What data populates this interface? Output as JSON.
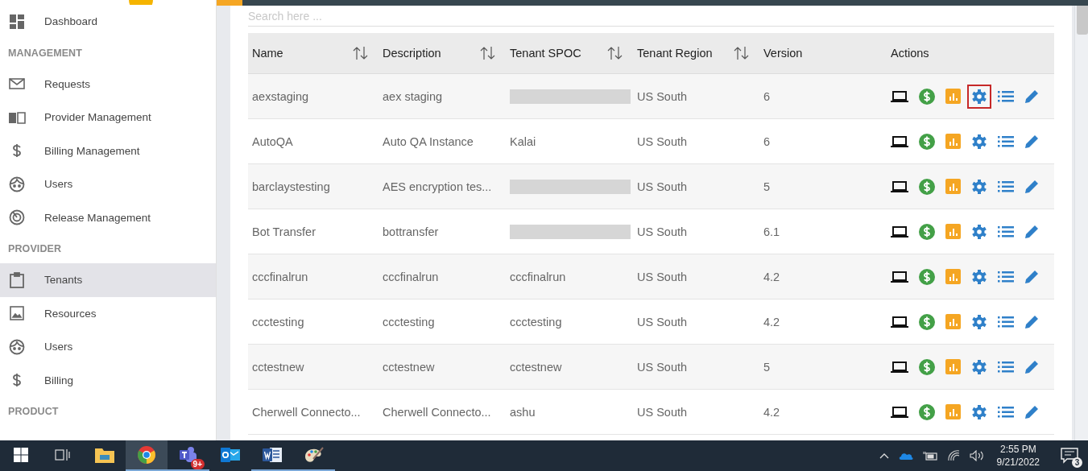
{
  "sidebar": {
    "items": [
      {
        "kind": "item",
        "label": "Dashboard",
        "selected": false
      },
      {
        "kind": "header",
        "label": "MANAGEMENT"
      },
      {
        "kind": "item",
        "label": "Requests",
        "selected": false
      },
      {
        "kind": "item",
        "label": "Provider Management",
        "selected": false
      },
      {
        "kind": "item",
        "label": "Billing Management",
        "selected": false
      },
      {
        "kind": "item",
        "label": "Users",
        "selected": false
      },
      {
        "kind": "item",
        "label": "Release Management",
        "selected": false
      },
      {
        "kind": "header",
        "label": "PROVIDER"
      },
      {
        "kind": "item",
        "label": "Tenants",
        "selected": true
      },
      {
        "kind": "item",
        "label": "Resources",
        "selected": false
      },
      {
        "kind": "item",
        "label": "Users",
        "selected": false
      },
      {
        "kind": "item",
        "label": "Billing",
        "selected": false
      },
      {
        "kind": "header",
        "label": "PRODUCT"
      }
    ]
  },
  "search": {
    "placeholder": "Search here ..."
  },
  "table": {
    "columns": [
      {
        "label": "Name",
        "sortable": true
      },
      {
        "label": "Description",
        "sortable": true
      },
      {
        "label": "Tenant SPOC",
        "sortable": true
      },
      {
        "label": "Tenant Region",
        "sortable": true
      },
      {
        "label": "Version",
        "sortable": false
      },
      {
        "label": "Actions",
        "sortable": false
      }
    ],
    "rows": [
      {
        "name": "aexstaging",
        "description": "aex staging",
        "spoc_redacted": true,
        "region": "US South",
        "version": "6",
        "settings_highlighted": true
      },
      {
        "name": "AutoQA",
        "description": "Auto QA Instance",
        "spoc": "Kalai",
        "spoc_redacted": false,
        "region": "US South",
        "version": "6",
        "settings_highlighted": false
      },
      {
        "name": "barclaystesting",
        "description": "AES encryption tes...",
        "spoc_redacted": true,
        "region": "US South",
        "version": "5",
        "settings_highlighted": false
      },
      {
        "name": "Bot Transfer",
        "description": "bottransfer",
        "spoc_redacted": true,
        "region": "US South",
        "version": "6.1",
        "settings_highlighted": false
      },
      {
        "name": "cccfinalrun",
        "description": "cccfinalrun",
        "spoc": "cccfinalrun",
        "spoc_redacted": false,
        "region": "US South",
        "version": "4.2",
        "settings_highlighted": false
      },
      {
        "name": "ccctesting",
        "description": "ccctesting",
        "spoc": "ccctesting",
        "spoc_redacted": false,
        "region": "US South",
        "version": "4.2",
        "settings_highlighted": false
      },
      {
        "name": "cctestnew",
        "description": "cctestnew",
        "spoc": "cctestnew",
        "spoc_redacted": false,
        "region": "US South",
        "version": "5",
        "settings_highlighted": false
      },
      {
        "name": "Cherwell Connecto...",
        "description": "Cherwell Connecto...",
        "spoc": "ashu",
        "spoc_redacted": false,
        "region": "US South",
        "version": "4.2",
        "settings_highlighted": false
      }
    ]
  },
  "taskbar": {
    "apps": [
      {
        "kind": "start",
        "active": false,
        "running": false
      },
      {
        "kind": "taskview",
        "active": false,
        "running": false
      },
      {
        "kind": "explorer",
        "active": false,
        "running": false
      },
      {
        "kind": "chrome",
        "active": true,
        "running": true
      },
      {
        "kind": "teams",
        "active": false,
        "running": true,
        "badge": "9+"
      },
      {
        "kind": "outlook",
        "active": false,
        "running": false
      },
      {
        "kind": "word",
        "active": false,
        "running": true
      },
      {
        "kind": "paint",
        "active": false,
        "running": true
      }
    ],
    "time": "2:55 PM",
    "date": "9/21/2022",
    "notifications": "3"
  }
}
